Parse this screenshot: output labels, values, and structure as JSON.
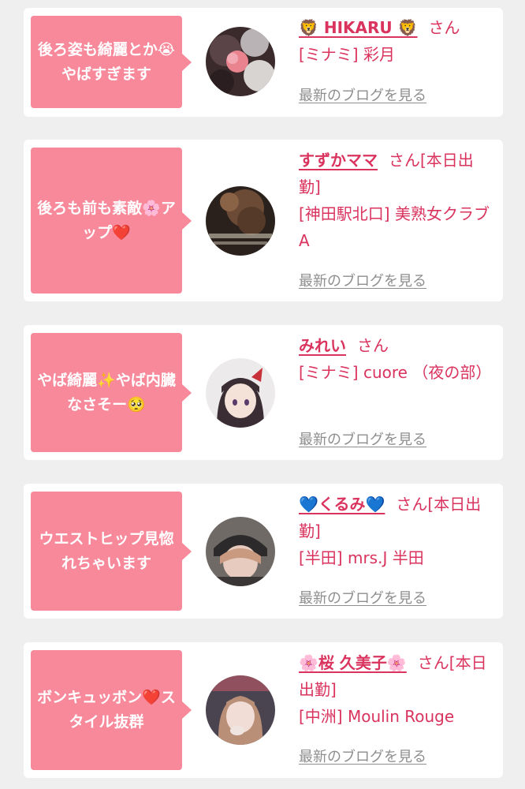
{
  "cards": [
    {
      "message": "後ろ姿も綺麗とか😭やばすぎます",
      "name": "🦁 HIKARU 🦁",
      "suffix": "さん",
      "shop": "[ミナミ] 彩月",
      "blog_link": "最新のブログを見る"
    },
    {
      "message": "後ろも前も素敵🌸アップ❤️",
      "name": "すずかママ",
      "suffix": "さん[本日出勤]",
      "shop": "[神田駅北口] 美熟女クラブA",
      "blog_link": "最新のブログを見る"
    },
    {
      "message": "やば綺麗✨やば内臓なさそー🥺",
      "name": "みれい",
      "suffix": "さん",
      "shop": "[ミナミ] cuore （夜の部）",
      "blog_link": "最新のブログを見る"
    },
    {
      "message": "ウエストヒップ見惚れちゃいます",
      "name": "💙くるみ💙",
      "suffix": "さん[本日出勤]",
      "shop": "[半田] mrs.J 半田",
      "blog_link": "最新のブログを見る"
    },
    {
      "message": "ボンキュッボン❤️スタイル抜群",
      "name": "🌸桜 久美子🌸",
      "suffix": "さん[本日出勤]",
      "shop": "[中洲] Moulin Rouge",
      "blog_link": "最新のブログを見る"
    }
  ],
  "colors": {
    "page_background": "#efefef",
    "bubble": "#f7899b",
    "accent_text": "#d9335e",
    "link_gray": "#8e8e8e"
  }
}
